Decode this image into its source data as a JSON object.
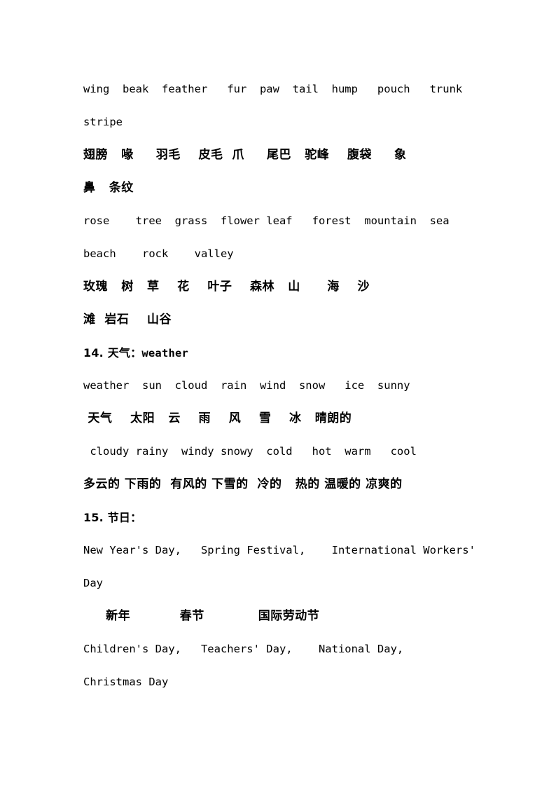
{
  "document": {
    "background_color": "#ffffff",
    "text_color": "#000000"
  },
  "blocks": [
    {
      "id": "animal-parts",
      "lines": [
        {
          "kind": "en",
          "text": "wing  beak  feather   fur  paw  tail  hump   pouch   trunk"
        },
        {
          "kind": "en",
          "text": "stripe"
        },
        {
          "kind": "zh",
          "text": "翅膀   喙     羽毛    皮毛  爪     尾巴   驼峰    腹袋     象"
        },
        {
          "kind": "zh",
          "text": "鼻   条纹"
        }
      ]
    },
    {
      "id": "nature",
      "lines": [
        {
          "kind": "en",
          "text": "rose    tree  grass  flower leaf   forest  mountain  sea"
        },
        {
          "kind": "en",
          "text": "beach    rock    valley"
        },
        {
          "kind": "zh",
          "text": "玫瑰   树   草    花    叶子    森林   山      海    沙"
        },
        {
          "kind": "zh",
          "text": "滩  岩石    山谷"
        }
      ]
    },
    {
      "id": "weather",
      "heading": {
        "number": "14.",
        "cjk": "天气：",
        "gloss": "weather"
      },
      "lines": [
        {
          "kind": "en",
          "text": "weather  sun  cloud  rain  wind  snow   ice  sunny"
        },
        {
          "kind": "zh",
          "text": " 天气    太阳   云    雨    风    雪    冰   晴朗的"
        },
        {
          "kind": "en",
          "text": " cloudy rainy  windy snowy  cold   hot  warm   cool"
        },
        {
          "kind": "zh",
          "text": "多云的 下雨的  有风的 下雪的  冷的   热的 温暖的 凉爽的"
        }
      ]
    },
    {
      "id": "festivals",
      "heading": {
        "number": "15.",
        "cjk": "节日：",
        "gloss": ""
      },
      "lines": [
        {
          "kind": "en",
          "text": "New Year's Day,   Spring Festival,    International Workers'"
        },
        {
          "kind": "en",
          "text": "Day"
        },
        {
          "kind": "zh",
          "text": "     新年           春节            国际劳动节"
        },
        {
          "kind": "en",
          "text": "Children's Day,   Teachers' Day,    National Day,"
        },
        {
          "kind": "en",
          "text": "Christmas Day"
        }
      ]
    }
  ]
}
